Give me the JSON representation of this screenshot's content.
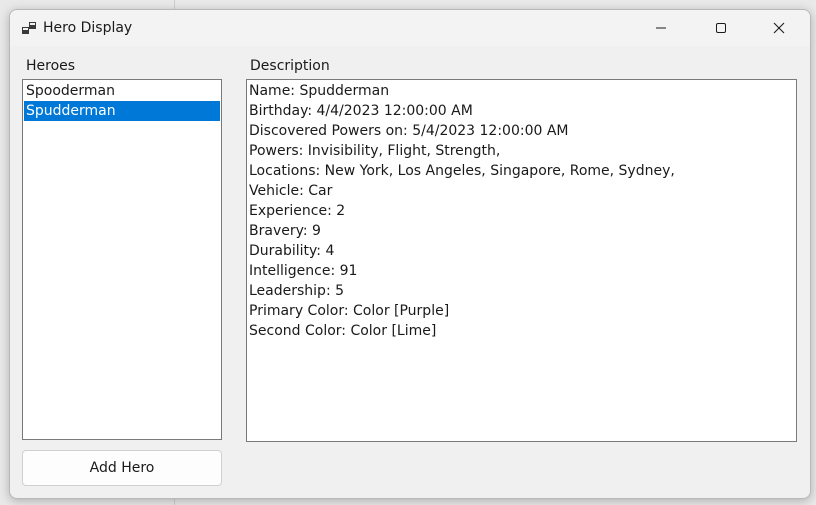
{
  "window": {
    "title": "Hero Display"
  },
  "titlebar": {
    "icon": "app-window-icon",
    "minimize_icon": "minimize-icon",
    "maximize_icon": "maximize-icon",
    "close_icon": "close-icon"
  },
  "heroes": {
    "label": "Heroes",
    "items": [
      {
        "label": "Spooderman",
        "selected": false
      },
      {
        "label": "Spudderman",
        "selected": true
      }
    ],
    "selection_color": "#0078d7"
  },
  "description": {
    "label": "Description",
    "lines": [
      "Name: Spudderman",
      "Birthday: 4/4/2023 12:00:00 AM",
      "Discovered Powers on: 5/4/2023 12:00:00 AM",
      "Powers: Invisibility, Flight, Strength,",
      "Locations: New York, Los Angeles, Singapore, Rome, Sydney,",
      "Vehicle: Car",
      "Experience: 2",
      "Bravery: 9",
      "Durability: 4",
      "Intelligence: 91",
      "Leadership: 5",
      "Primary Color: Color [Purple]",
      "Second Color: Color [Lime]"
    ]
  },
  "actions": {
    "add_hero_label": "Add Hero"
  }
}
